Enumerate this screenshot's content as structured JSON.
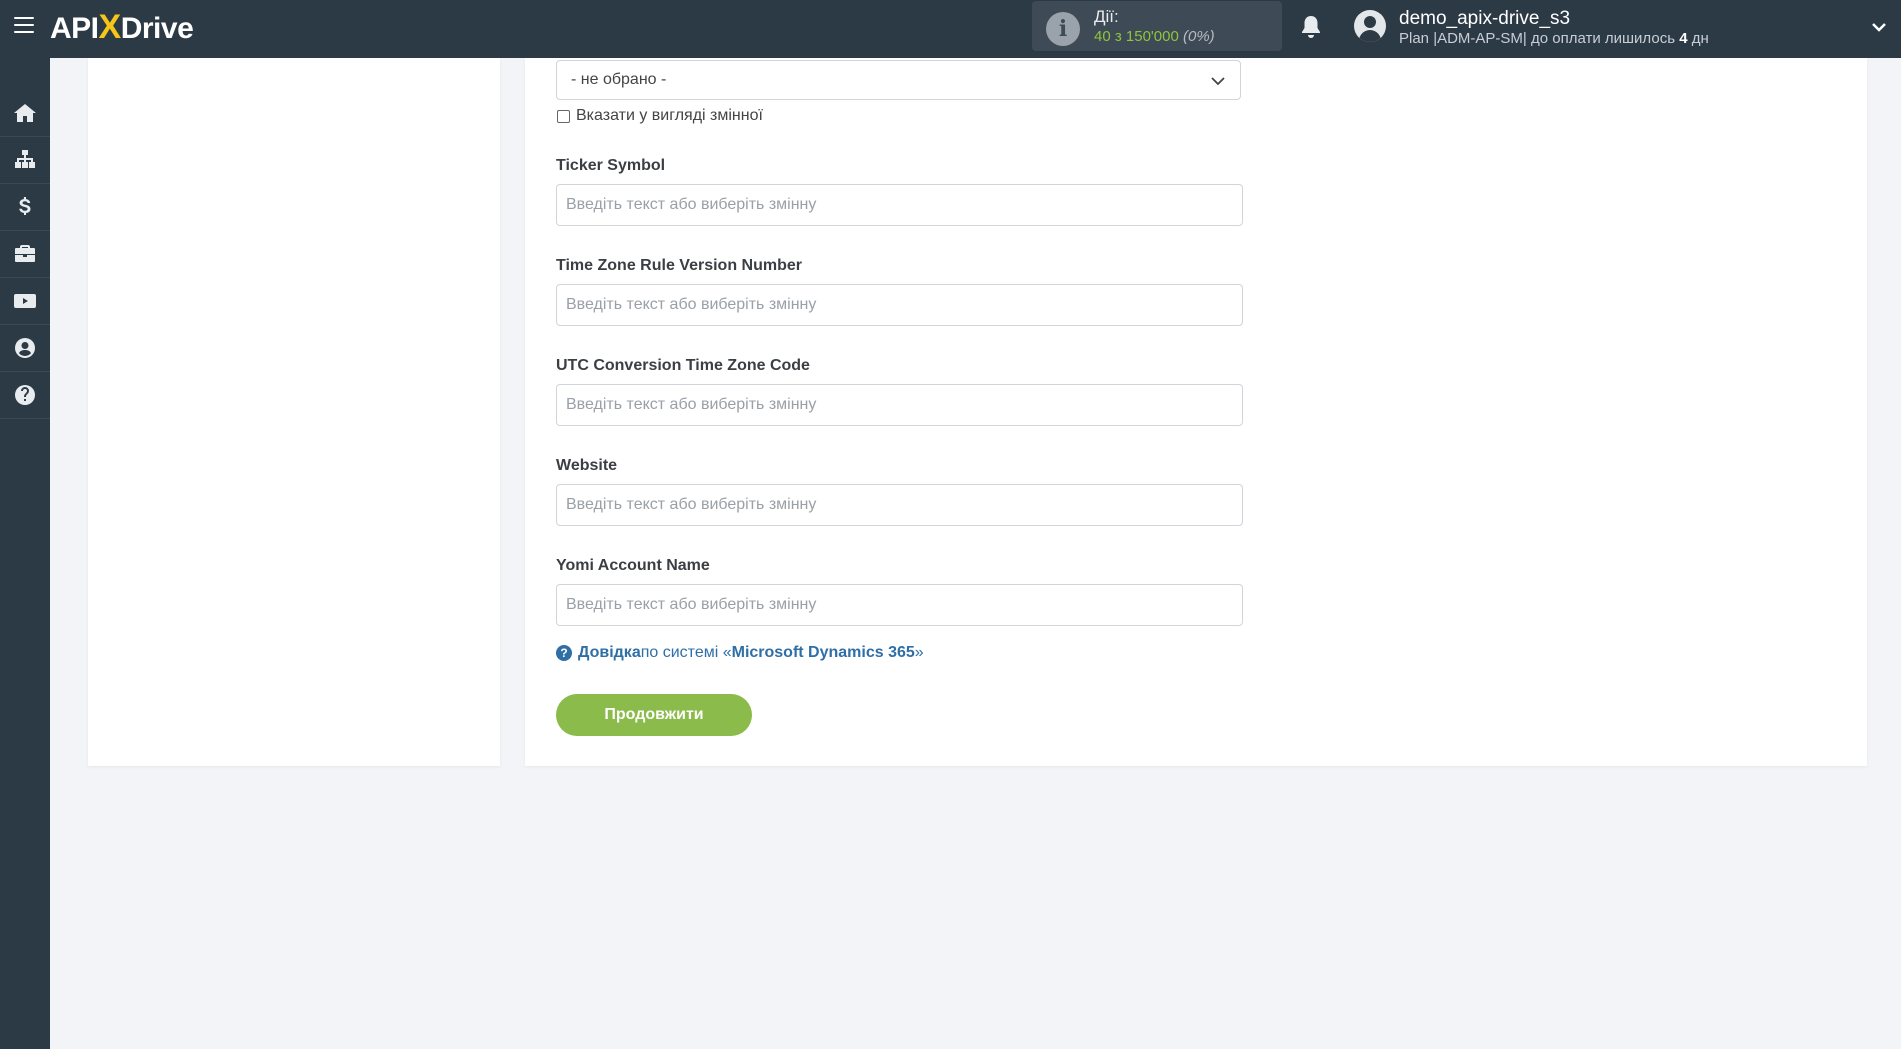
{
  "header": {
    "logo_api": "API",
    "logo_x": "X",
    "logo_drive": "Drive",
    "actions_label": "Дії:",
    "actions_count": "40 з 150'000",
    "actions_percent": "(0%)",
    "user_name": "demo_apix-drive_s3",
    "plan_prefix": "Plan |ADM-AP-SM| до оплати лишилось ",
    "plan_days": "4",
    "plan_suffix": " дн"
  },
  "sidebar": {
    "items": [
      {
        "icon": "home-icon"
      },
      {
        "icon": "sitemap-icon"
      },
      {
        "icon": "dollar-icon"
      },
      {
        "icon": "briefcase-icon"
      },
      {
        "icon": "youtube-icon"
      },
      {
        "icon": "user-circle-icon"
      },
      {
        "icon": "question-circle-icon"
      }
    ]
  },
  "form": {
    "select_value": "- не обрано -",
    "checkbox_label": "Вказати у вигляді змінної",
    "fields": [
      {
        "label": "Ticker Symbol",
        "placeholder": "Введіть текст або виберіть змінну"
      },
      {
        "label": "Time Zone Rule Version Number",
        "placeholder": "Введіть текст або виберіть змінну"
      },
      {
        "label": "UTC Conversion Time Zone Code",
        "placeholder": "Введіть текст або виберіть змінну"
      },
      {
        "label": "Website",
        "placeholder": "Введіть текст або виберіть змінну"
      },
      {
        "label": "Yomi Account Name",
        "placeholder": "Введіть текст або виберіть змінну"
      }
    ],
    "help_link": "Довідка",
    "help_middle": " по системі «",
    "help_system": "Microsoft Dynamics 365",
    "help_end": "»",
    "continue_label": "Продовжити"
  },
  "colors": {
    "topbar": "#2c3a46",
    "accent_green": "#8bbb4a",
    "link_blue": "#2f6fa6",
    "logo_x": "#f5c518"
  }
}
